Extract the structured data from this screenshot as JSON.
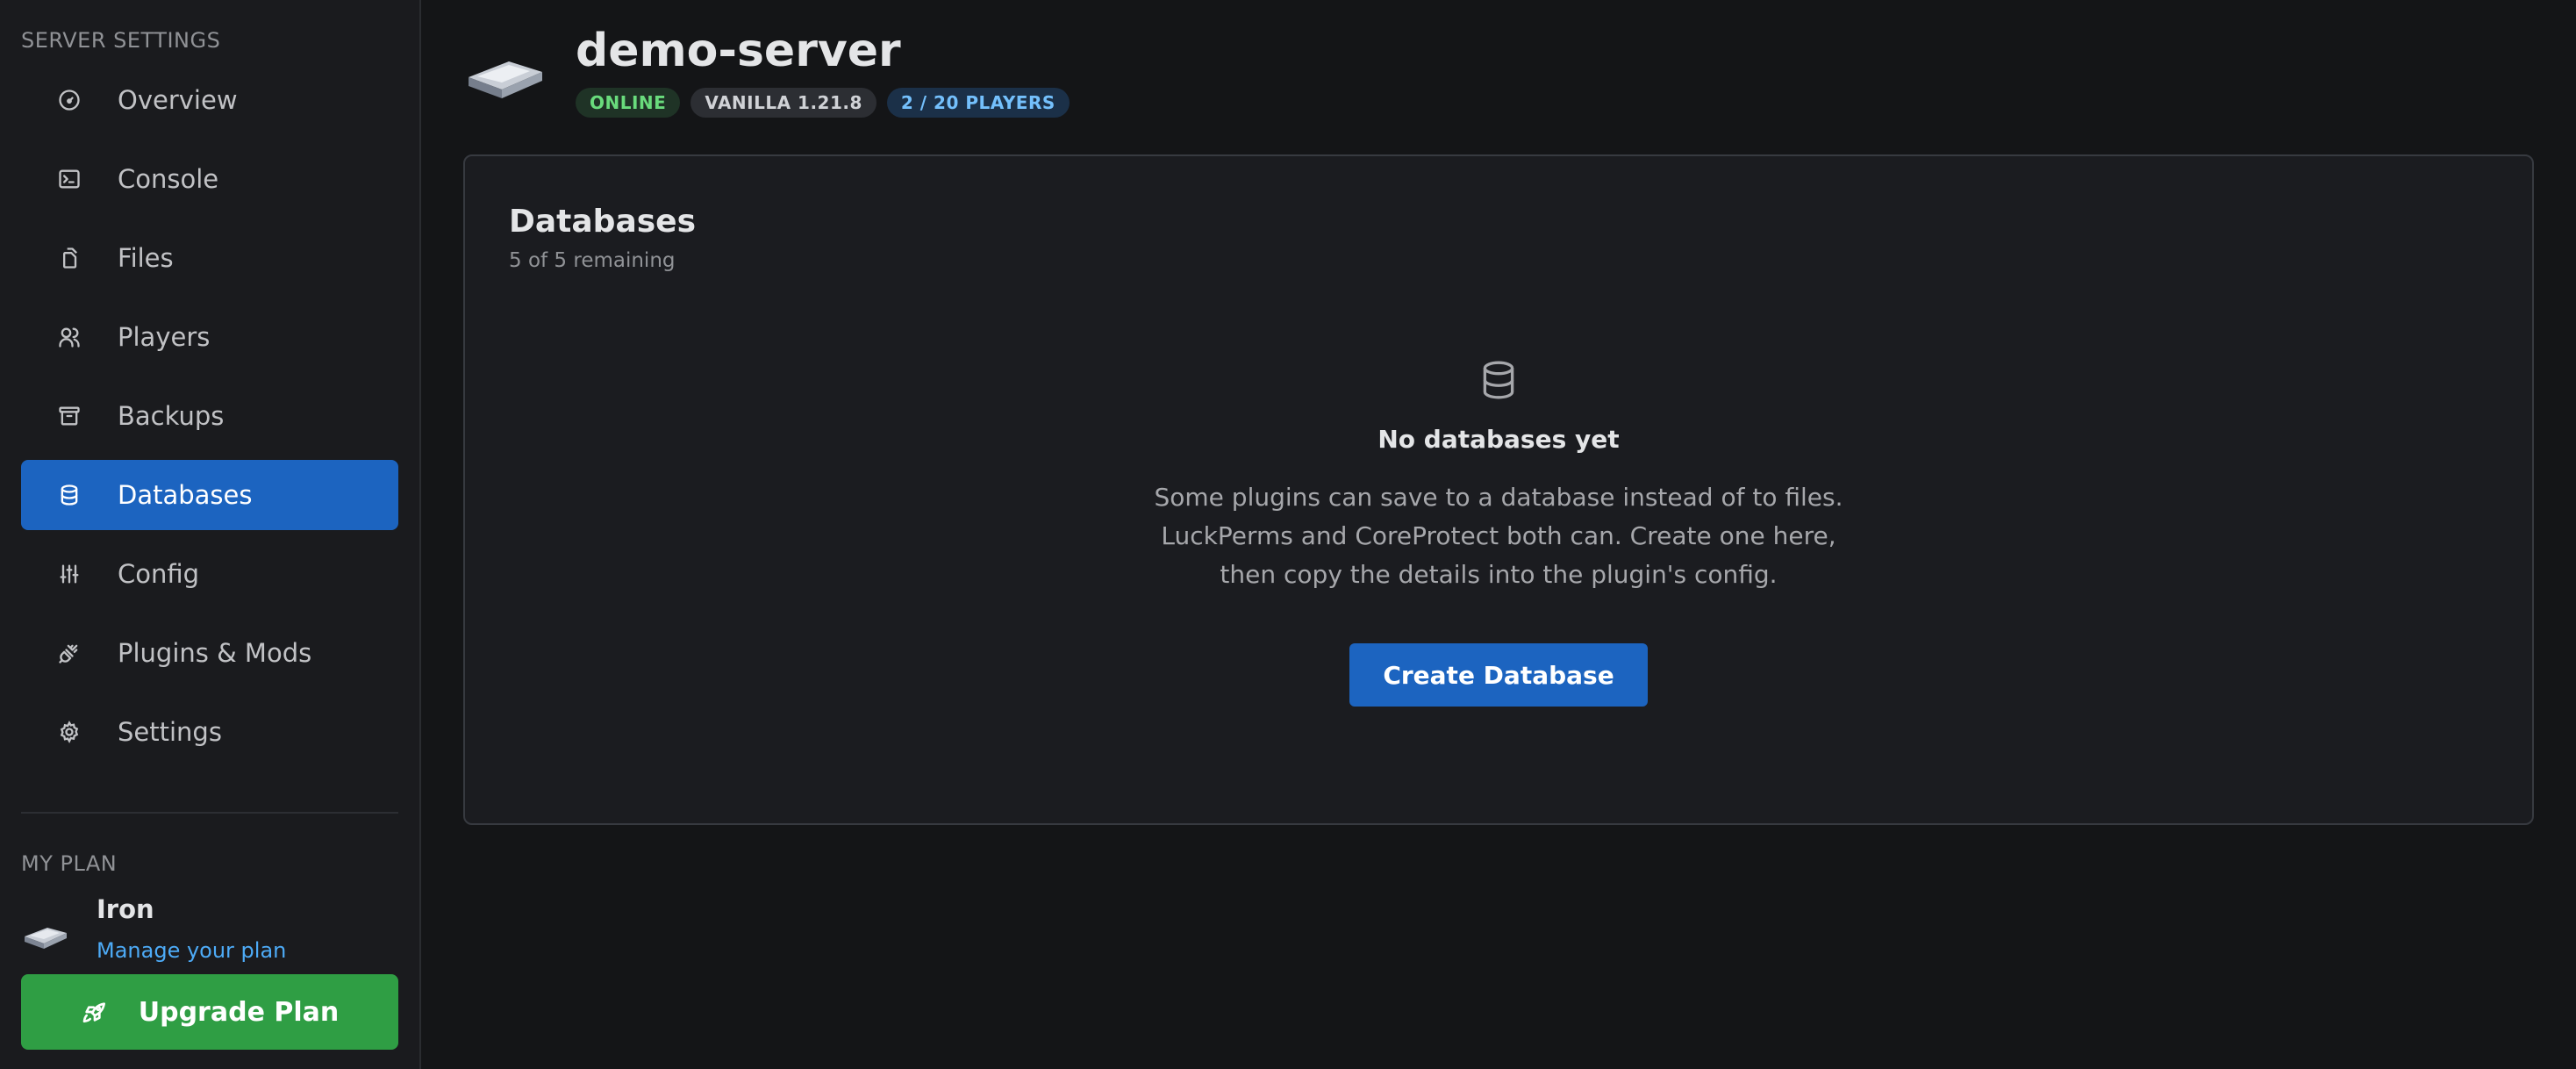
{
  "sidebar": {
    "section_title": "SERVER SETTINGS",
    "items": [
      {
        "label": "Overview",
        "icon": "gauge-icon",
        "active": false
      },
      {
        "label": "Console",
        "icon": "terminal-icon",
        "active": false
      },
      {
        "label": "Files",
        "icon": "files-icon",
        "active": false
      },
      {
        "label": "Players",
        "icon": "users-icon",
        "active": false
      },
      {
        "label": "Backups",
        "icon": "archive-icon",
        "active": false
      },
      {
        "label": "Databases",
        "icon": "database-icon",
        "active": true
      },
      {
        "label": "Config",
        "icon": "sliders-icon",
        "active": false
      },
      {
        "label": "Plugins & Mods",
        "icon": "plug-icon",
        "active": false
      },
      {
        "label": "Settings",
        "icon": "gear-icon",
        "active": false
      }
    ],
    "plan_title": "MY PLAN",
    "plan_name": "Iron",
    "plan_link": "Manage your plan",
    "upgrade_label": "Upgrade Plan"
  },
  "header": {
    "server_name": "demo-server",
    "badges": {
      "status": "ONLINE",
      "version": "VANILLA 1.21.8",
      "players": "2 / 20 PLAYERS"
    }
  },
  "databases": {
    "title": "Databases",
    "remaining": "5 of 5 remaining",
    "empty_title": "No databases yet",
    "empty_line1": "Some plugins can save to a database instead of to files.",
    "empty_line2": "LuckPerms and CoreProtect both can. Create one here,",
    "empty_line3": "then copy the details into the plugin's config.",
    "create_label": "Create Database"
  },
  "colors": {
    "accent": "#1c64c0",
    "success": "#2f9e44",
    "background": "#141517",
    "sidebar": "#1a1b1e"
  }
}
